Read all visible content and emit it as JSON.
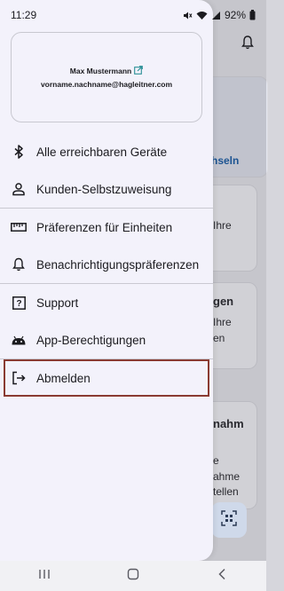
{
  "status_bar": {
    "time": "11:29",
    "battery": "92%",
    "icons": [
      "mute-icon",
      "wifi-icon",
      "signal-icon",
      "battery-icon"
    ]
  },
  "drawer": {
    "profile": {
      "name": "Max Mustermann",
      "email": "vorname.nachname@hagleitner.com",
      "icon": "external-link-icon"
    },
    "items": [
      {
        "label": "Alle erreichbaren Geräte",
        "icon": "bluetooth-icon"
      },
      {
        "label": "Kunden-Selbstzuweisung",
        "icon": "person-icon"
      },
      {
        "label": "Präferenzen für Einheiten",
        "icon": "ruler-icon"
      },
      {
        "label": "Benachrichtigungspräferenzen",
        "icon": "bell-icon"
      },
      {
        "label": "Support",
        "icon": "help-icon"
      },
      {
        "label": "App-Berechtigungen",
        "icon": "android-icon"
      },
      {
        "label": "Abmelden",
        "icon": "logout-icon"
      }
    ]
  },
  "background": {
    "link": "hseln",
    "texts": [
      "Ihre",
      "gen",
      "Ihre",
      "en",
      "nahm",
      "e",
      "ahme",
      "tellen"
    ],
    "bell_icon": "bell-icon",
    "fab_icon": "qr-scan-icon"
  },
  "nav_bar": {
    "buttons": [
      "recent-apps-icon",
      "home-icon",
      "back-icon"
    ]
  },
  "colors": {
    "drawer_bg": "#f3f2fb",
    "highlight_border": "#8a3b32",
    "link": "#1b5fa8"
  }
}
